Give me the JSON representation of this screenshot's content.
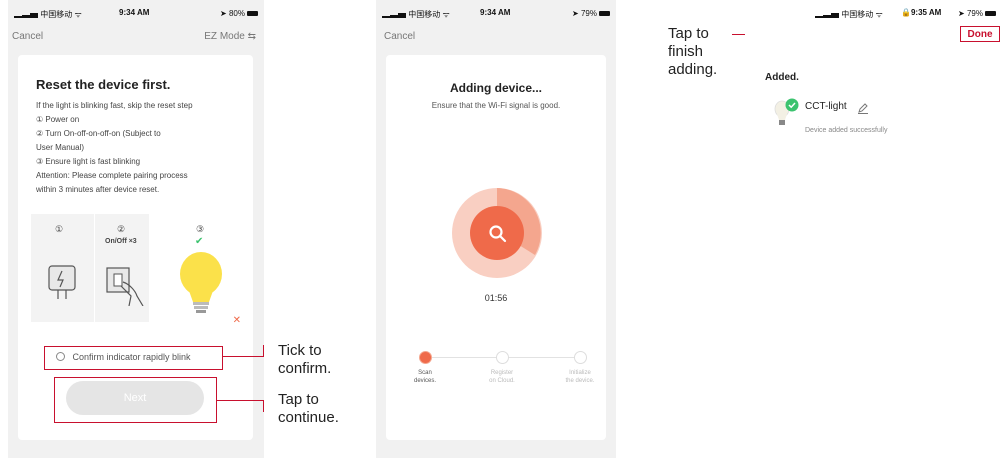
{
  "screen1": {
    "status": {
      "carrier": "中国移动",
      "time": "9:34 AM",
      "battery": "80%"
    },
    "nav": {
      "cancel": "Cancel",
      "mode": "EZ Mode ⇆"
    },
    "title": "Reset the device first.",
    "instructions": [
      "If the light is blinking fast, skip the reset step",
      "① Power on",
      "② Turn On-off-on-off-on (Subject to",
      "User Manual)",
      "③ Ensure light is fast blinking",
      "Attention: Please complete pairing process",
      "within 3 minutes after device reset."
    ],
    "illustration": {
      "step1": "①",
      "step2": "②",
      "step2_caption": "On/Off ×3",
      "step3": "③"
    },
    "confirm_label": "Confirm indicator rapidly blink",
    "next_button": "Next"
  },
  "screen2": {
    "status": {
      "carrier": "中国移动",
      "time": "9:34 AM",
      "battery": "79%"
    },
    "nav": {
      "cancel": "Cancel"
    },
    "title": "Adding device...",
    "subtitle": "Ensure that the Wi-Fi signal is good.",
    "timer": "01:56",
    "steps": [
      {
        "label1": "Scan",
        "label2": "devices."
      },
      {
        "label1": "Register",
        "label2": "on Cloud."
      },
      {
        "label1": "Initialize",
        "label2": "the device."
      }
    ],
    "accent_color": "#ef6a4a"
  },
  "screen3": {
    "status": {
      "carrier": "中国移动",
      "time": "9:35 AM",
      "battery": "79%"
    },
    "done_button": "Done",
    "section_title": "Added.",
    "device_name": "CCT-light",
    "device_status": "Device added successfully",
    "success_color": "#3cc36f"
  },
  "annotations": {
    "tick_line1": "Tick to",
    "tick_line2": "confirm.",
    "tap_continue_line1": "Tap to",
    "tap_continue_line2": "continue.",
    "finish_line1": "Tap to",
    "finish_line2": "finish",
    "finish_line3": "adding."
  }
}
